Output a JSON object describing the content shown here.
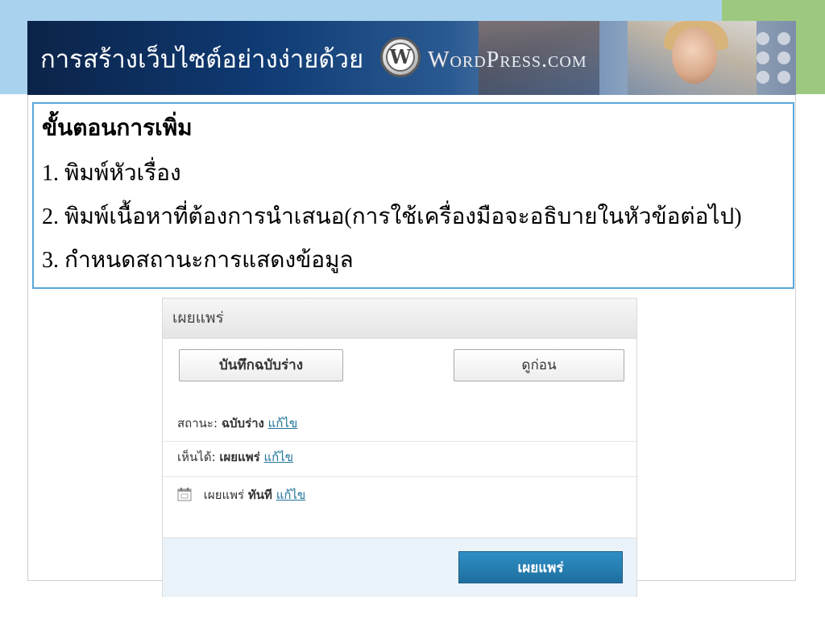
{
  "colors": {
    "top_bar_blue": "#a9d2ee",
    "top_bar_green": "#9cc97f",
    "content_border": "#5aa6dc",
    "link": "#21759b",
    "publish_button": "#1f6f9f"
  },
  "header": {
    "title": "การสร้างเว็บไซต์อย่างง่ายด้วย",
    "logo_letter": "W",
    "brand_text": "WordPress.com"
  },
  "content": {
    "steps_title": "ขั้นตอนการเพิ่ม",
    "steps": [
      "1. พิมพ์หัวเรื่อง",
      "2. พิมพ์เนื้อหาที่ต้องการนำเสนอ(การใช้เครื่องมือจะอธิบายในหัวข้อต่อไป)",
      "3. กำหนดสถานะการแสดงข้อมูล"
    ]
  },
  "widget": {
    "title": "เผยแพร่",
    "save_draft_label": "บันทึกฉบับร่าง",
    "preview_label": "ดูก่อน",
    "status_label": "สถานะ:",
    "status_value": "ฉบับร่าง",
    "status_edit": "แก้ไข",
    "visibility_label": "เห็นได้:",
    "visibility_value": "เผยแพร่",
    "visibility_edit": "แก้ไข",
    "schedule_icon": "calendar-icon",
    "schedule_label": "เผยแพร่",
    "schedule_value": "ทันที",
    "schedule_edit": "แก้ไข",
    "publish_label": "เผยแพร่"
  }
}
